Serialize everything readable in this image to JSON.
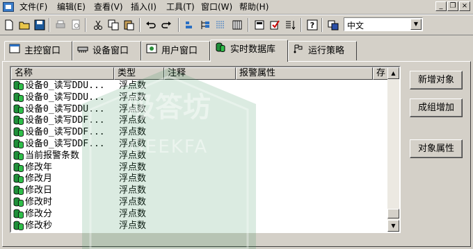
{
  "menubar": {
    "items": [
      "文件(F)",
      "编辑(E)",
      "查看(V)",
      "插入(I)",
      "工具(T)",
      "窗口(W)",
      "帮助(H)"
    ]
  },
  "toolbar": {
    "language": "中文"
  },
  "tabs": [
    {
      "label": "主控窗口",
      "icon": "main-window-icon"
    },
    {
      "label": "设备窗口",
      "icon": "device-window-icon"
    },
    {
      "label": "用户窗口",
      "icon": "user-window-icon"
    },
    {
      "label": "实时数据库",
      "icon": "database-icon",
      "active": true
    },
    {
      "label": "运行策略",
      "icon": "strategy-icon"
    }
  ],
  "list": {
    "columns": [
      "名称",
      "类型",
      "注释",
      "报警属性",
      "存"
    ],
    "rows": [
      {
        "name": "设备0_读写DDU...",
        "type": "浮点数"
      },
      {
        "name": "设备0_读写DDU...",
        "type": "浮点数"
      },
      {
        "name": "设备0_读写DDU...",
        "type": "浮点数"
      },
      {
        "name": "设备0_读写DDF...",
        "type": "浮点数"
      },
      {
        "name": "设备0_读写DDF...",
        "type": "浮点数"
      },
      {
        "name": "设备0_读写DDF...",
        "type": "浮点数"
      },
      {
        "name": "当前报警条数",
        "type": "浮点数"
      },
      {
        "name": "修改年",
        "type": "浮点数"
      },
      {
        "name": "修改月",
        "type": "浮点数"
      },
      {
        "name": "修改日",
        "type": "浮点数"
      },
      {
        "name": "修改时",
        "type": "浮点数"
      },
      {
        "name": "修改分",
        "type": "浮点数"
      },
      {
        "name": "修改秒",
        "type": "浮点数"
      }
    ]
  },
  "buttons": {
    "add_object": "新增对象",
    "group_add": "成组增加",
    "object_properties": "对象属性"
  },
  "watermark": {
    "text": "吸答坊",
    "latin": "GEEKFA"
  },
  "colors": {
    "chrome": "#d4d0c8",
    "db_icon": "#1f8f3a",
    "watermark": "#3a8f5a"
  }
}
